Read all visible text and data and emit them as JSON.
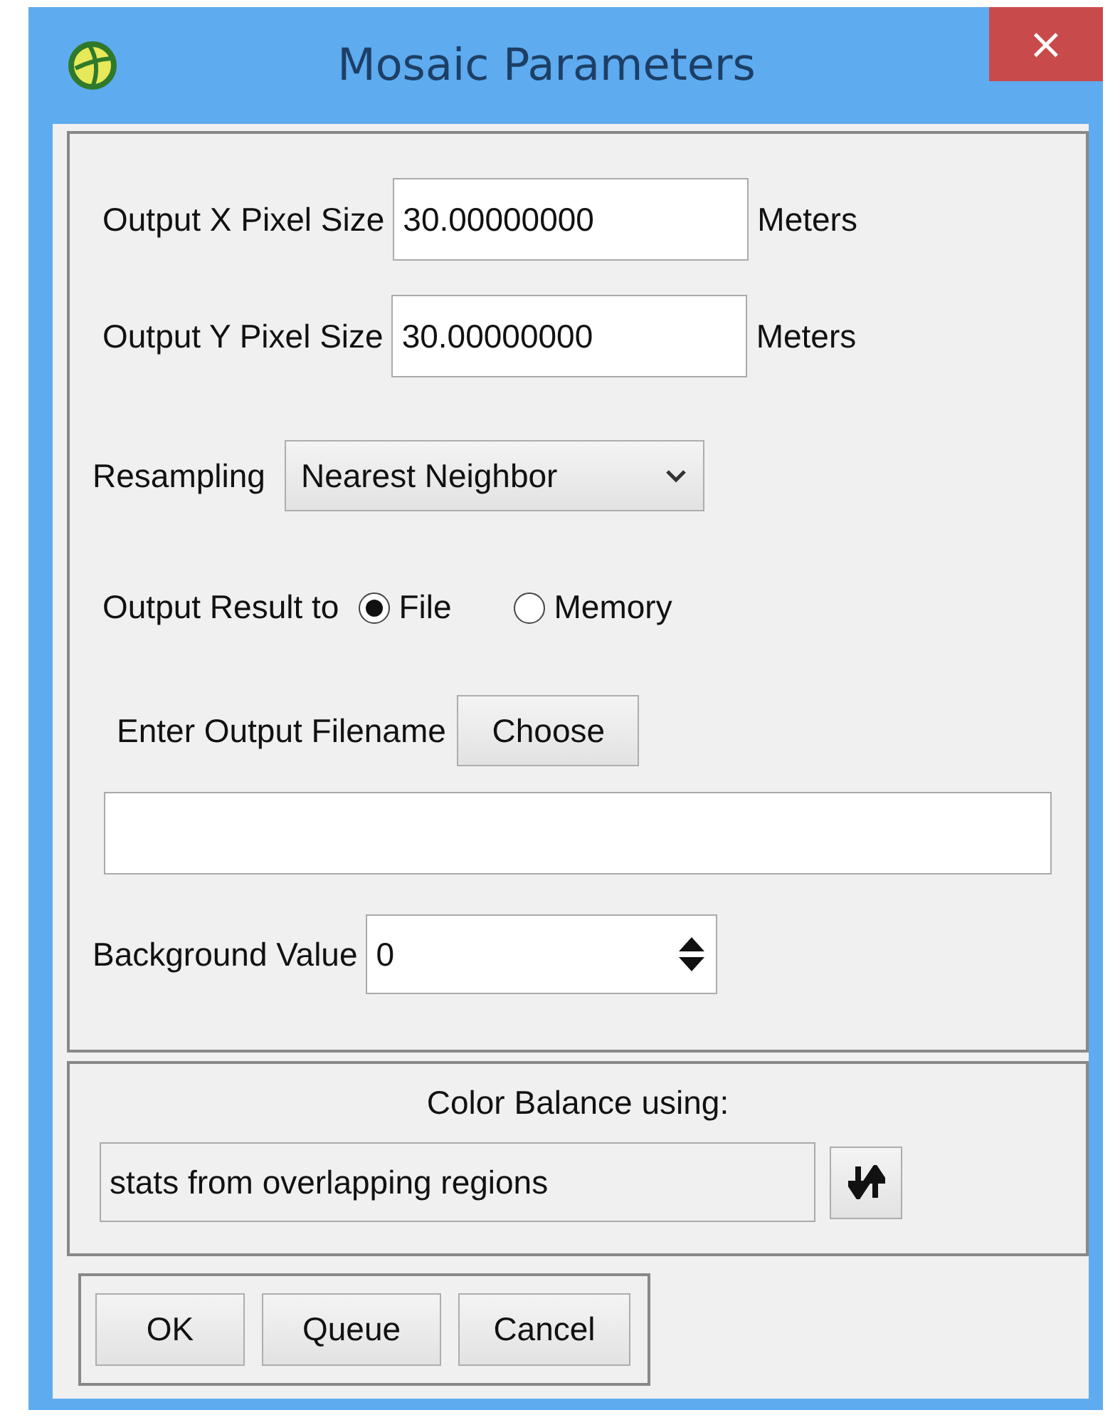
{
  "window": {
    "title": "Mosaic Parameters",
    "close": "×"
  },
  "pixel_sizes": [
    {
      "label": "Output X Pixel Size",
      "value": "30.00000000",
      "unit": "Meters"
    },
    {
      "label": "Output Y Pixel Size",
      "value": "30.00000000",
      "unit": "Meters"
    }
  ],
  "resampling": {
    "label": "Resampling",
    "value": "Nearest Neighbor"
  },
  "output_result": {
    "label": "Output Result to",
    "options": [
      {
        "label": "File",
        "selected": true
      },
      {
        "label": "Memory",
        "selected": false
      }
    ]
  },
  "output_filename": {
    "label": "Enter Output Filename",
    "button": "Choose"
  },
  "background_value": {
    "label": "Background Value",
    "value": "0"
  },
  "color_balance": {
    "label": "Color Balance using:",
    "value": "stats from overlapping regions"
  },
  "buttons": [
    "OK",
    "Queue",
    "Cancel"
  ]
}
